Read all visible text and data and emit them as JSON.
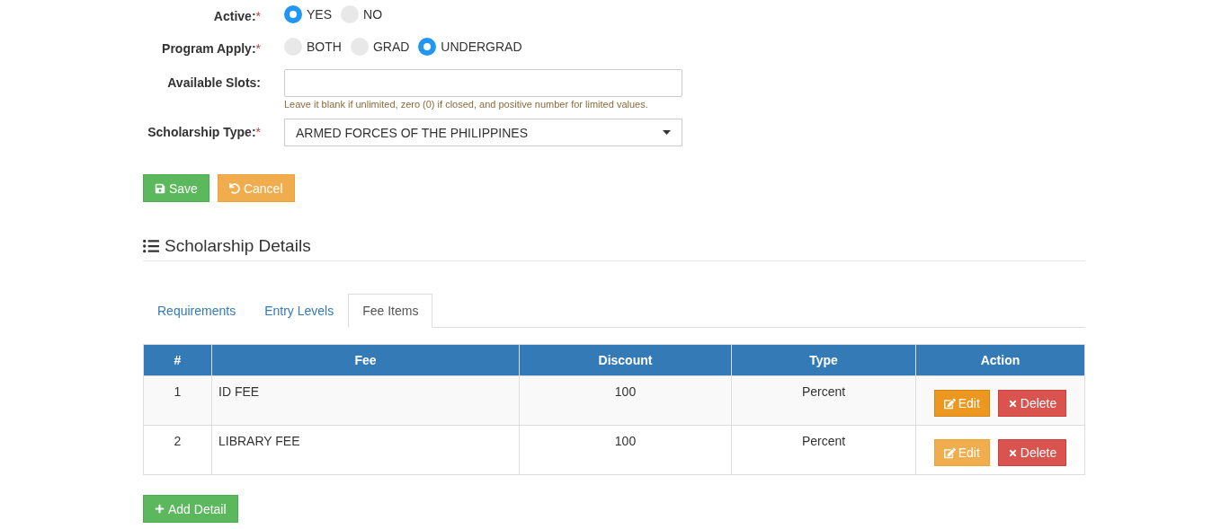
{
  "form": {
    "active": {
      "label": "Active:",
      "required": "*",
      "options": [
        {
          "label": "YES",
          "selected": true
        },
        {
          "label": "NO",
          "selected": false
        }
      ]
    },
    "program_apply": {
      "label": "Program Apply:",
      "required": "*",
      "options": [
        {
          "label": "BOTH",
          "selected": false
        },
        {
          "label": "GRAD",
          "selected": false
        },
        {
          "label": "UNDERGRAD",
          "selected": true
        }
      ]
    },
    "available_slots": {
      "label": "Available Slots:",
      "help": "Leave it blank if unlimited, zero (0) if closed, and positive number for limited values."
    },
    "scholarship_type": {
      "label": "Scholarship Type:",
      "required": "*",
      "value": "ARMED FORCES OF THE PHILIPPINES"
    },
    "buttons": [
      {
        "kind": "save",
        "label": "Save"
      },
      {
        "kind": "cancel",
        "label": "Cancel"
      }
    ]
  },
  "details": {
    "title": "Scholarship Details",
    "tabs": [
      {
        "label": "Requirements",
        "selected": false
      },
      {
        "label": "Entry Levels",
        "selected": false
      },
      {
        "label": "Fee Items",
        "selected": true
      }
    ],
    "table": {
      "columns": [
        "#",
        "Fee",
        "Discount",
        "Type",
        "Action"
      ],
      "rows": [
        {
          "number": "1",
          "fee": "ID FEE",
          "discount": "100",
          "type": "Percent",
          "hovered": true,
          "edit": "Edit",
          "delete": "Delete"
        },
        {
          "number": "2",
          "fee": "LIBRARY FEE",
          "discount": "100",
          "type": "Percent",
          "hovered": false,
          "edit": "Edit",
          "delete": "Delete"
        }
      ]
    },
    "add_button": "Add Detail"
  }
}
